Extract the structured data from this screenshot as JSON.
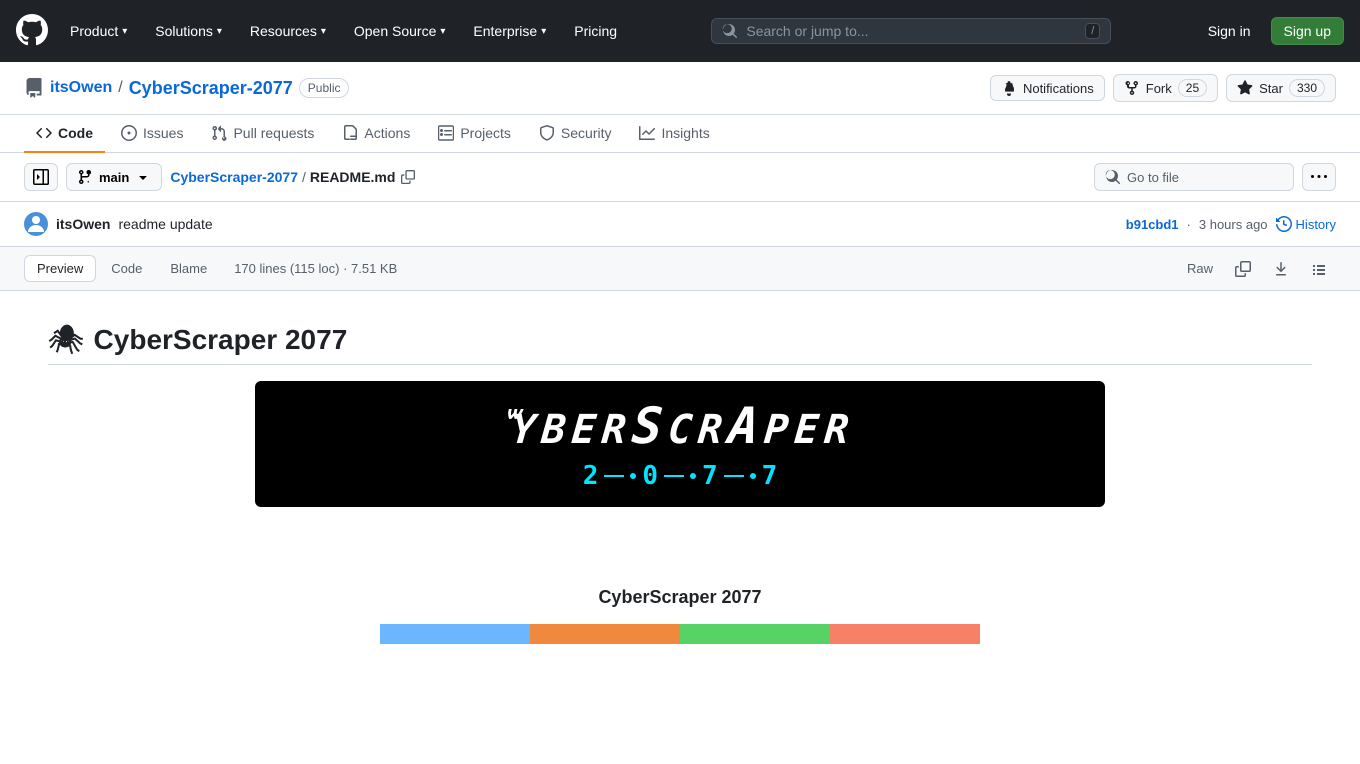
{
  "nav": {
    "product_label": "Product",
    "solutions_label": "Solutions",
    "resources_label": "Resources",
    "open_source_label": "Open Source",
    "enterprise_label": "Enterprise",
    "pricing_label": "Pricing",
    "search_placeholder": "Search or jump to...",
    "search_shortcut": "/",
    "signin_label": "Sign in",
    "signup_label": "Sign up"
  },
  "repo": {
    "owner": "itsOwen",
    "name": "CyberScraper-2077",
    "visibility": "Public",
    "notifications_label": "Notifications",
    "fork_label": "Fork",
    "fork_count": "25",
    "star_label": "Star",
    "star_count": "330"
  },
  "tabs": [
    {
      "id": "code",
      "label": "Code",
      "active": true
    },
    {
      "id": "issues",
      "label": "Issues",
      "active": false
    },
    {
      "id": "pull-requests",
      "label": "Pull requests",
      "active": false
    },
    {
      "id": "actions",
      "label": "Actions",
      "active": false
    },
    {
      "id": "projects",
      "label": "Projects",
      "active": false
    },
    {
      "id": "security",
      "label": "Security",
      "active": false
    },
    {
      "id": "insights",
      "label": "Insights",
      "active": false
    }
  ],
  "file_toolbar": {
    "branch": "main",
    "breadcrumb_repo": "CyberScraper-2077",
    "breadcrumb_sep": "/",
    "breadcrumb_file": "README.md",
    "goto_file_placeholder": "Go to file"
  },
  "commit": {
    "author": "itsOwen",
    "message": "readme update",
    "hash": "b91cbd1",
    "time_ago": "3 hours ago",
    "history_label": "History"
  },
  "file_view": {
    "preview_label": "Preview",
    "code_label": "Code",
    "blame_label": "Blame",
    "meta": "170 lines (115 loc) · 7.51 KB",
    "raw_label": "Raw"
  },
  "readme": {
    "emoji": "🕷",
    "title": "CyberScraper 2077",
    "banner_title": "CyberScraper",
    "banner_nums": [
      "2",
      "0",
      "7",
      "7"
    ],
    "chart_title": "CyberScraper 2077",
    "bars": [
      {
        "color": "#6cb6ff",
        "label": "blue"
      },
      {
        "color": "#f0883e",
        "label": "orange"
      },
      {
        "color": "#56d364",
        "label": "green"
      },
      {
        "color": "#f78166",
        "label": "pink"
      }
    ]
  }
}
